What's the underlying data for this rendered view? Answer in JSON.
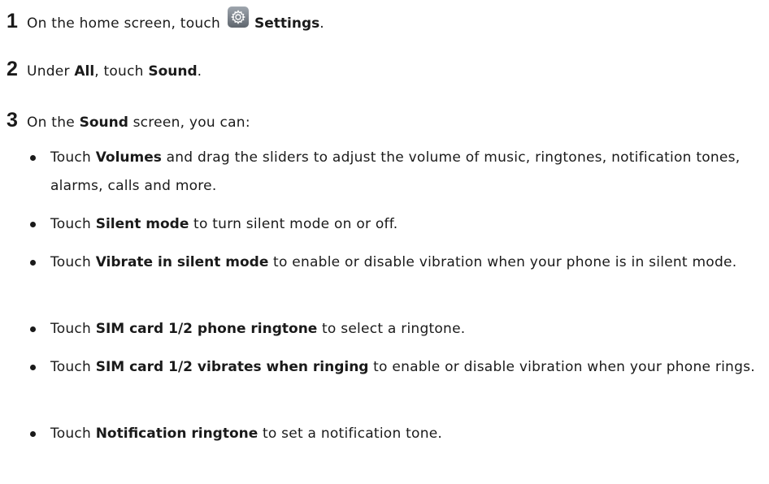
{
  "steps": [
    {
      "number": "1",
      "p1": "On the home screen, touch",
      "b1": "Settings",
      "p2": "."
    },
    {
      "number": "2",
      "p1": "Under",
      "b1": "All",
      "p2": ", touch",
      "b2": "Sound",
      "p3": "."
    },
    {
      "number": "3",
      "p1": "On the",
      "b1": "Sound",
      "p2": "screen, you can:"
    }
  ],
  "bullets": [
    {
      "p1": "Touch",
      "b1": "Volumes",
      "p2": "and drag the sliders to adjust the volume of music, ringtones, notification tones, alarms, calls and more."
    },
    {
      "p1": "Touch",
      "b1": "Silent mode",
      "p2": "to turn silent mode on or off."
    },
    {
      "p1": "Touch",
      "b1": "Vibrate in silent mode",
      "p2": "to enable or disable vibration when your phone is in silent mode."
    },
    {
      "p1": "Touch",
      "b1": "SIM card 1/2 phone ringtone",
      "p2": "to select a ringtone."
    },
    {
      "p1": "Touch",
      "b1": "SIM card 1/2 vibrates when ringing",
      "p2": "to enable or disable vibration when your phone rings."
    },
    {
      "p1": "Touch",
      "b1": "Notification ringtone",
      "p2": "to set a notification tone."
    }
  ],
  "icons": {
    "settings": "settings-gear-icon"
  },
  "colors": {
    "text": "#1a1a1a",
    "icon_bg_top": "#9fa6ae",
    "icon_bg_bottom": "#5e656d"
  }
}
